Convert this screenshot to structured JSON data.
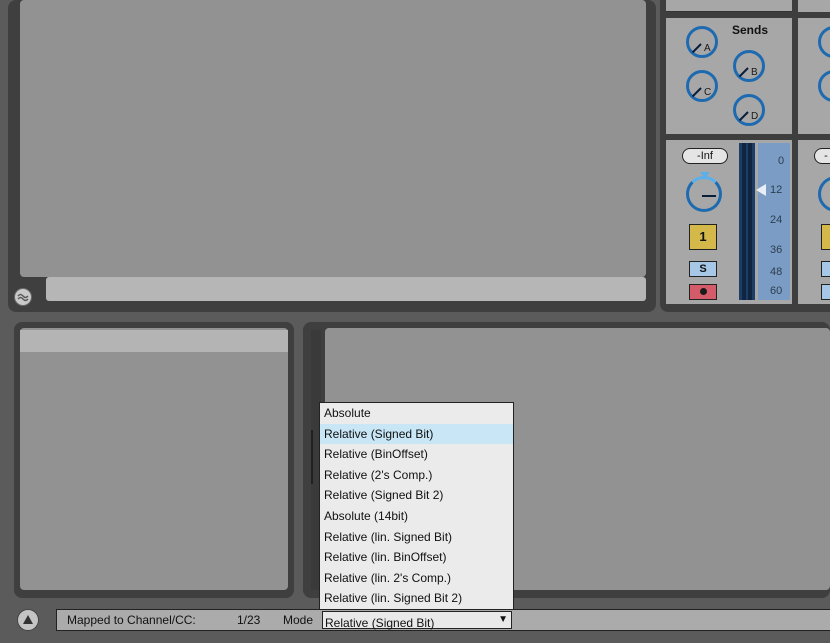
{
  "mixer": {
    "sends_label": "Sends",
    "send_knobs": [
      "A",
      "B",
      "C",
      "D"
    ],
    "volume_readout": "-Inf",
    "meter_scale": [
      "0",
      "12",
      "24",
      "36",
      "48",
      "60"
    ],
    "track_number": "1",
    "solo_label": "S",
    "pan_level": 0.55,
    "partial_readout": "-"
  },
  "dropdown": {
    "options": [
      "Absolute",
      "Relative (Signed Bit)",
      "Relative (BinOffset)",
      "Relative (2's Comp.)",
      "Relative (Signed Bit 2)",
      "Absolute (14bit)",
      "Relative (lin. Signed Bit)",
      "Relative (lin. BinOffset)",
      "Relative (lin. 2's Comp.)",
      "Relative (lin. Signed Bit 2)"
    ],
    "selected_index": 1
  },
  "status": {
    "mapping_label": "Mapped to Channel/CC:",
    "mapping_value": "1/23",
    "mode_label": "Mode",
    "mode_value": "Relative (Signed Bit)"
  },
  "icons": {
    "groove": "groove-wave-icon",
    "triangle": "triangle-up-icon",
    "dropdown": "chevron-down-icon"
  },
  "colors": {
    "knob_ring": "#1e6ab0",
    "track_button": "#d4b84a",
    "selected_option": "#c8e6f6",
    "meter_fill": "#7b9cc4"
  }
}
